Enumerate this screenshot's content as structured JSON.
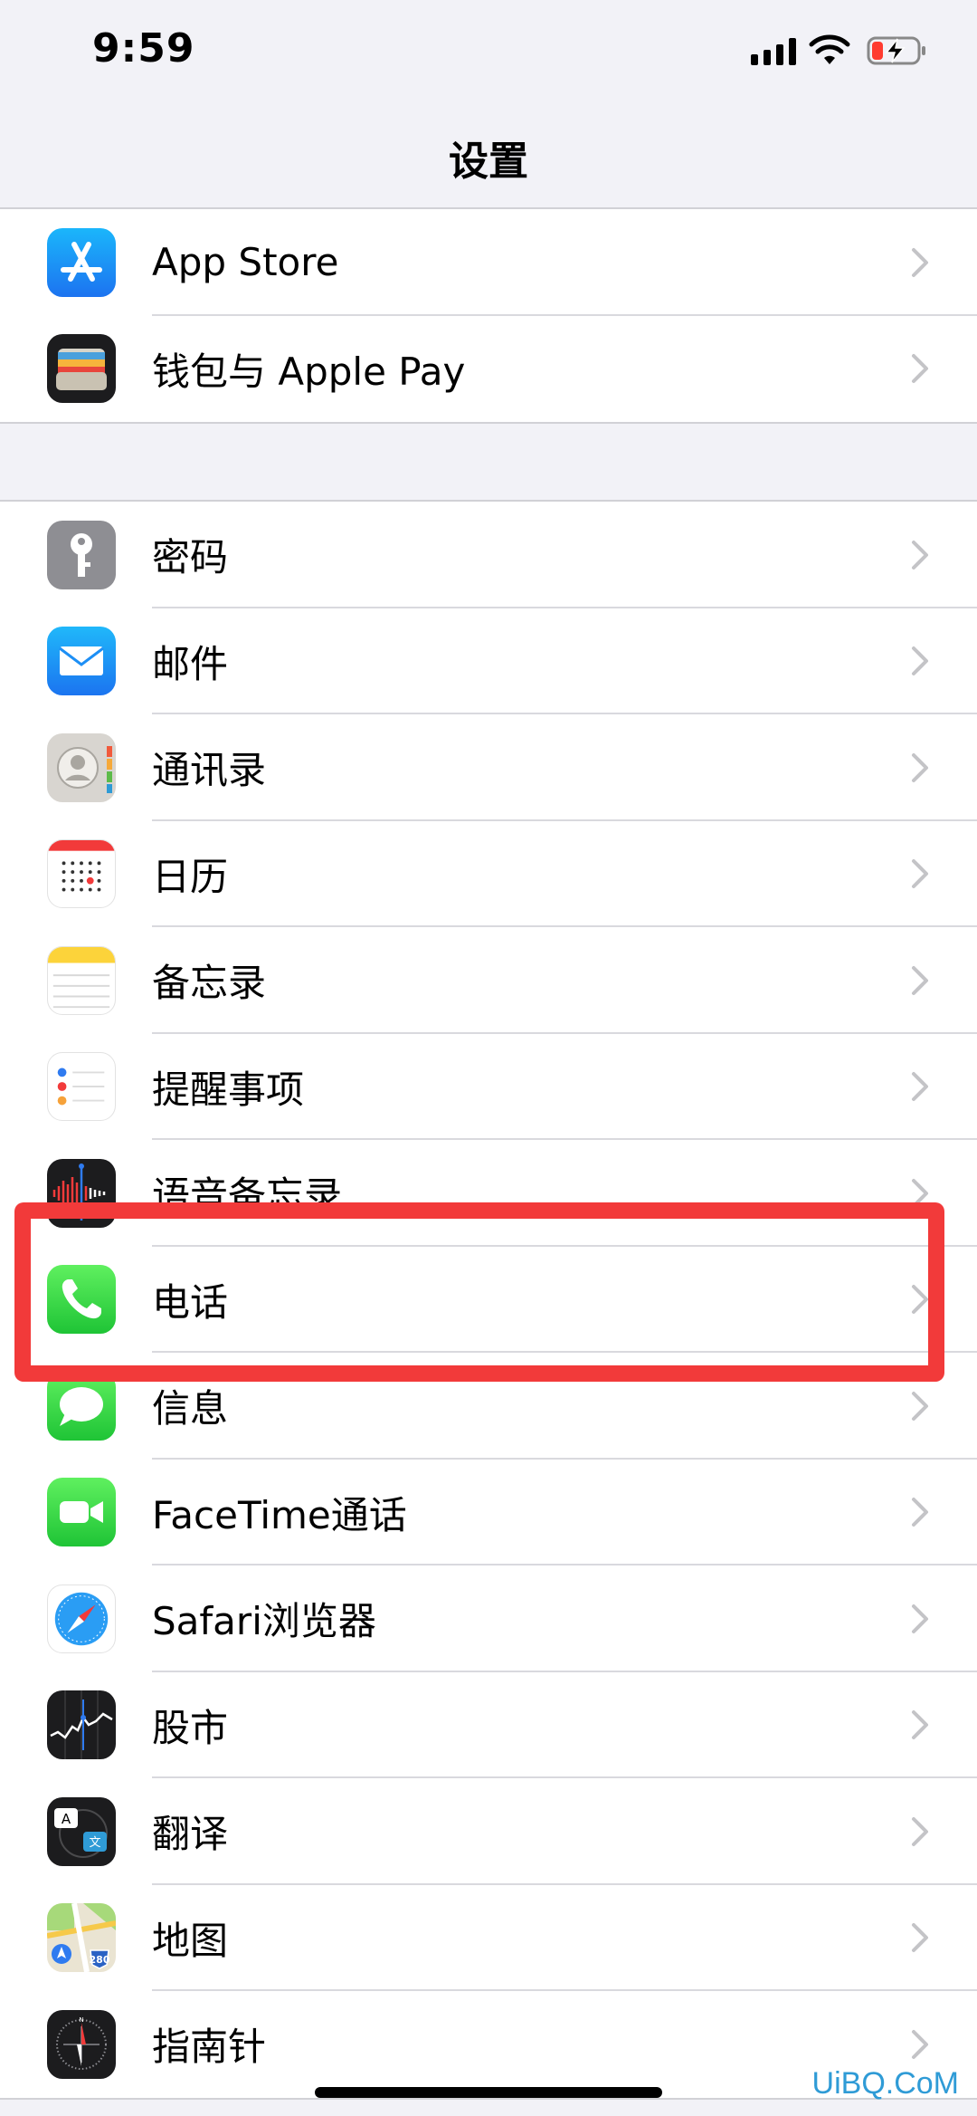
{
  "status_bar": {
    "time": "9:59"
  },
  "nav": {
    "title": "设置"
  },
  "group1": [
    {
      "name": "app-store",
      "label": "App Store",
      "icon": "app-store-icon"
    },
    {
      "name": "wallet",
      "label": "钱包与 Apple Pay",
      "icon": "wallet-icon"
    }
  ],
  "group2": [
    {
      "name": "passwords",
      "label": "密码",
      "icon": "key-icon"
    },
    {
      "name": "mail",
      "label": "邮件",
      "icon": "mail-icon"
    },
    {
      "name": "contacts",
      "label": "通讯录",
      "icon": "contacts-icon"
    },
    {
      "name": "calendar",
      "label": "日历",
      "icon": "calendar-icon"
    },
    {
      "name": "notes",
      "label": "备忘录",
      "icon": "notes-icon"
    },
    {
      "name": "reminders",
      "label": "提醒事项",
      "icon": "reminders-icon"
    },
    {
      "name": "voice-memos",
      "label": "语音备忘录",
      "icon": "voice-memos-icon"
    },
    {
      "name": "phone",
      "label": "电话",
      "icon": "phone-icon"
    },
    {
      "name": "messages",
      "label": "信息",
      "icon": "messages-icon"
    },
    {
      "name": "facetime",
      "label": "FaceTime通话",
      "icon": "facetime-icon"
    },
    {
      "name": "safari",
      "label": "Safari浏览器",
      "icon": "safari-compass-icon"
    },
    {
      "name": "stocks",
      "label": "股市",
      "icon": "stocks-icon"
    },
    {
      "name": "translate",
      "label": "翻译",
      "icon": "translate-icon"
    },
    {
      "name": "maps",
      "label": "地图",
      "icon": "maps-icon"
    },
    {
      "name": "compass",
      "label": "指南针",
      "icon": "compass-icon"
    }
  ],
  "watermark": "UiBQ.CoM",
  "colors": {
    "highlight": "#f23a3a",
    "background": "#f2f2f7"
  }
}
